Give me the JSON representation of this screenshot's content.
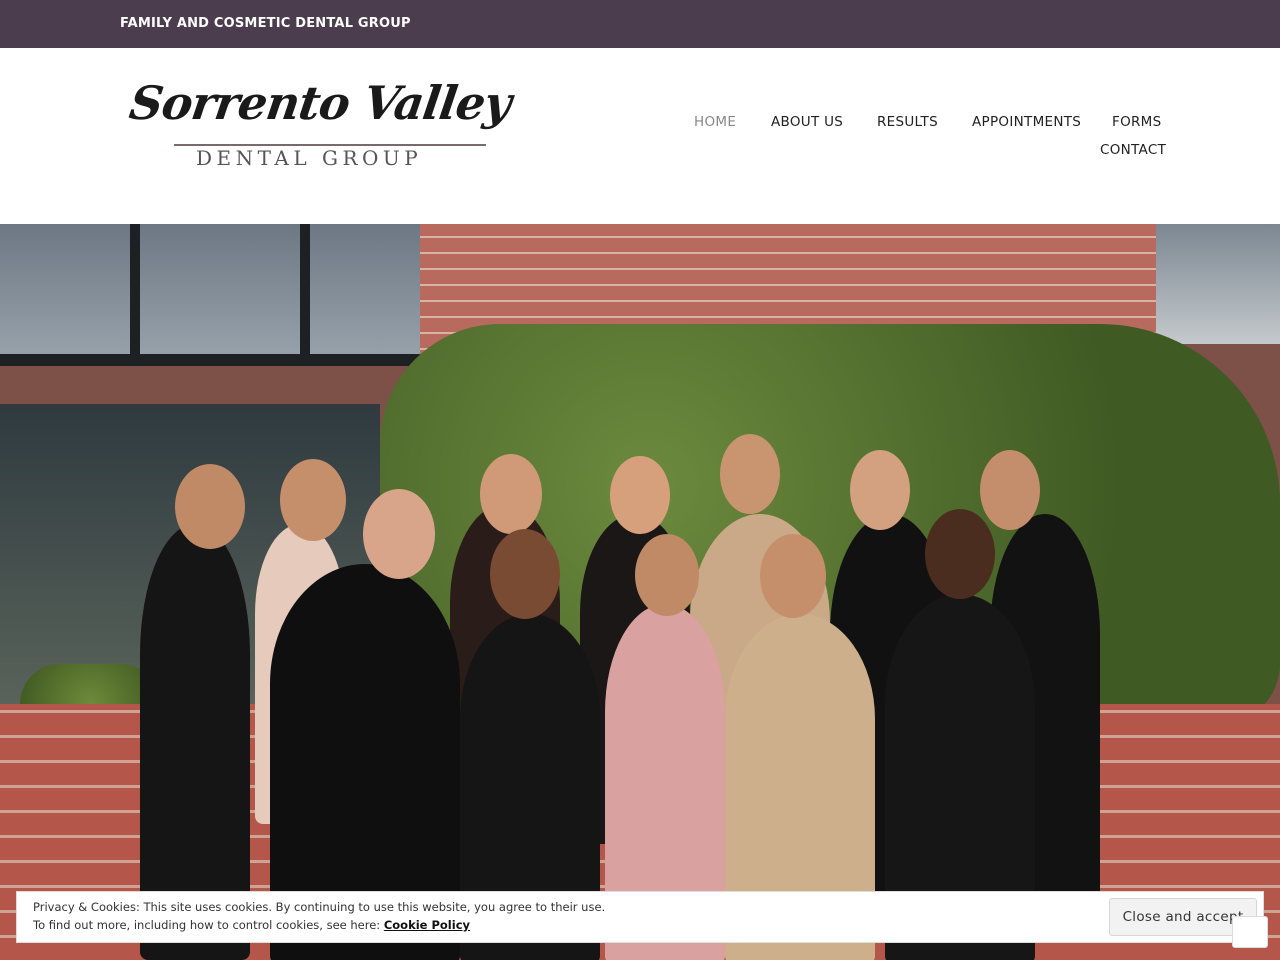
{
  "topbar": {
    "tagline": "FAMILY AND COSMETIC DENTAL GROUP",
    "background": "#4b3d4d"
  },
  "logo": {
    "script": "Sorrento Valley",
    "subtitle": "DENTAL GROUP"
  },
  "nav": {
    "items": [
      {
        "label": "HOME",
        "active": true
      },
      {
        "label": "ABOUT US"
      },
      {
        "label": "RESULTS"
      },
      {
        "label": "APPOINTMENTS"
      },
      {
        "label": "FORMS"
      },
      {
        "label": "CONTACT"
      }
    ]
  },
  "hero": {
    "image": "team-photo"
  },
  "cookie_banner": {
    "line1": "Privacy & Cookies: This site uses cookies. By continuing to use this website, you agree to their use.",
    "line2_prefix": "To find out more, including how to control cookies, see here: ",
    "link": "Cookie Policy",
    "button": "Close and accept"
  }
}
